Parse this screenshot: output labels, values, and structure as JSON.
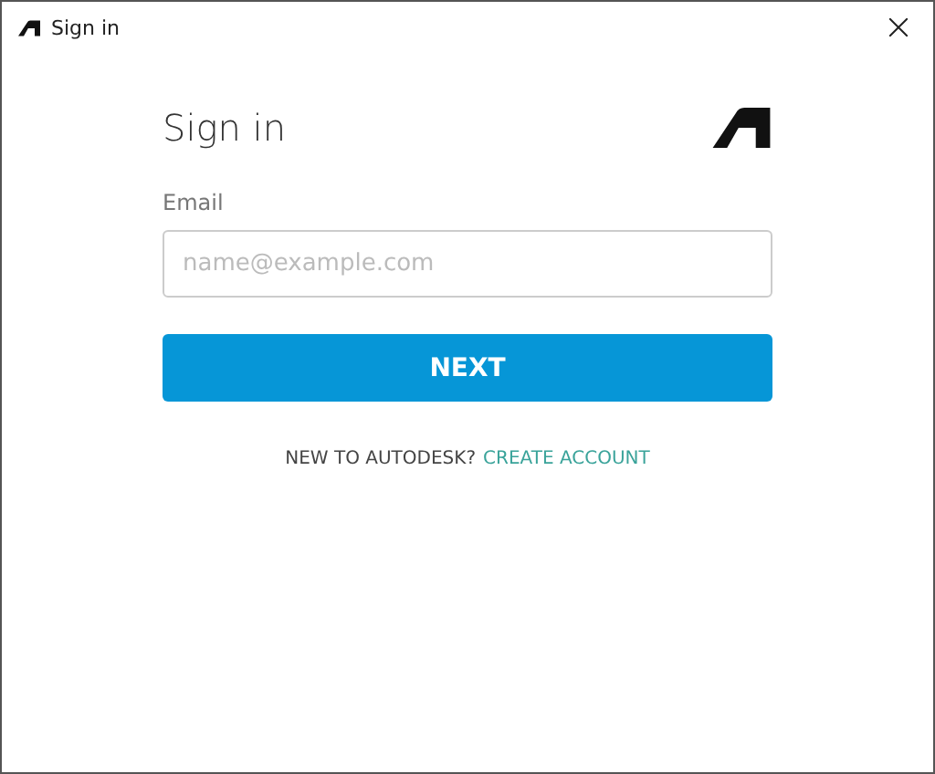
{
  "window": {
    "title": "Sign in"
  },
  "heading": "Sign in",
  "email": {
    "label": "Email",
    "placeholder": "name@example.com"
  },
  "next_button": "NEXT",
  "footer": {
    "prompt": "NEW TO AUTODESK?",
    "link": "CREATE ACCOUNT"
  }
}
